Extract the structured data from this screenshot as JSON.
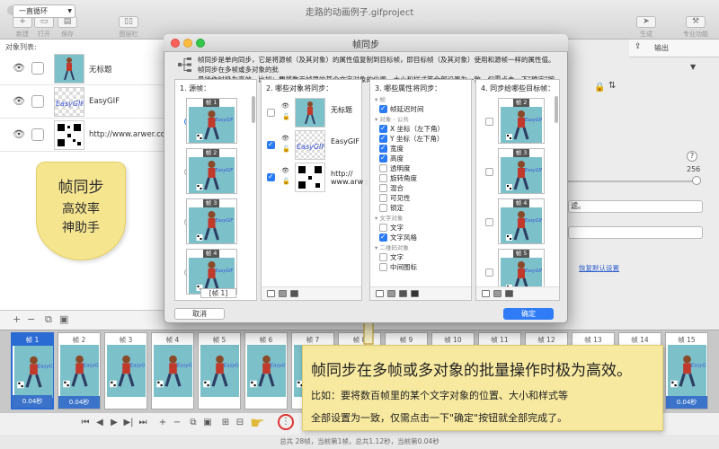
{
  "window": {
    "title": "走路的动画例子.gifproject"
  },
  "toolbar": {
    "new_label": "新建",
    "open_label": "打开",
    "save_label": "保存",
    "panel_label": "图层栏",
    "generate_label": "生成",
    "pro_label": "专业功能"
  },
  "object_panel": {
    "header": "对象列表:",
    "objects": [
      {
        "name": "无标题"
      },
      {
        "name": "EasyGIF"
      },
      {
        "name": "http://www.arwer.com"
      }
    ]
  },
  "slogan": {
    "line1": "帧同步",
    "line2": "高效率",
    "line3": "神助手"
  },
  "right_panel": {
    "export_label": "输出",
    "value_256": "256",
    "question": "?",
    "snippet1": "滤。",
    "snippet2": "恢复默认设置"
  },
  "dialog": {
    "title": "帧同步",
    "description_line1": "帧同步是单向同步，它是将源帧（及其对象）的属性值复制到目标帧，即目标帧（及其对象）使用和源帧一样的属性值。帧同步在多帧或多对象的批",
    "description_line2": "量操作时极为高效。比如：要将数百帧里的某个文字对象的位置、大小和样式等全部设置为一致，仅需点击一下\"确定\"按钮就全部完成了。",
    "col1_header": "1. 源帧：",
    "col2_header": "2. 哪些对象将同步：",
    "col3_header": "3. 哪些属性将同步：",
    "col4_header": "4. 同步给哪些目标帧：",
    "source_frames": [
      "帧 1",
      "帧 2",
      "帧 3",
      "帧 4"
    ],
    "selected_source": "帧 1",
    "objects": [
      {
        "name": "无标题",
        "checked": false
      },
      {
        "name": "EasyGIF",
        "checked": true
      },
      {
        "name": "http://\nwww.arw",
        "checked": true
      }
    ],
    "properties": [
      {
        "group": "帧"
      },
      {
        "label": "帧延迟时间",
        "checked": true
      },
      {
        "group": "对象 - 公共"
      },
      {
        "label": "X 坐标（左下角）",
        "checked": true
      },
      {
        "label": "Y 坐标（左下角）",
        "checked": true
      },
      {
        "label": "宽度",
        "checked": true
      },
      {
        "label": "高度",
        "checked": true
      },
      {
        "label": "透明度",
        "checked": false
      },
      {
        "label": "旋转角度",
        "checked": false
      },
      {
        "label": "混合",
        "checked": false
      },
      {
        "label": "可见性",
        "checked": false
      },
      {
        "label": "锁定",
        "checked": false
      },
      {
        "group": "文字对象"
      },
      {
        "label": "文字",
        "checked": false
      },
      {
        "label": "文字风格",
        "checked": true
      },
      {
        "group": "二维码对象"
      },
      {
        "label": "文字",
        "checked": false
      },
      {
        "label": "中间图标",
        "checked": false
      }
    ],
    "target_frames": [
      {
        "label": "帧 2",
        "checked": false
      },
      {
        "label": "帧 3",
        "checked": false
      },
      {
        "label": "帧 4",
        "checked": false
      },
      {
        "label": "帧 5",
        "checked": false
      }
    ],
    "source_footer": "[帧 1]",
    "cancel_label": "取消",
    "ok_label": "确定"
  },
  "frames": [
    {
      "label": "帧 1",
      "time": "0.04秒"
    },
    {
      "label": "帧 2",
      "time": "0.04秒"
    },
    {
      "label": "帧 3",
      "time": ""
    },
    {
      "label": "帧 4",
      "time": ""
    },
    {
      "label": "帧 5",
      "time": ""
    },
    {
      "label": "帧 6",
      "time": ""
    },
    {
      "label": "帧 7",
      "time": ""
    },
    {
      "label": "帧 8",
      "time": ""
    },
    {
      "label": "帧 9",
      "time": ""
    },
    {
      "label": "帧 10",
      "time": ""
    },
    {
      "label": "帧 11",
      "time": ""
    },
    {
      "label": "帧 12",
      "time": ""
    },
    {
      "label": "帧 13",
      "time": ""
    },
    {
      "label": "帧 14",
      "time": ""
    },
    {
      "label": "帧 15",
      "time": "0.04秒"
    }
  ],
  "controls": {
    "loop_label": "一直循环"
  },
  "status": "总共 28帧，当前第1帧，总共1.12秒，当前第0.04秒",
  "callout": {
    "title": "帧同步在多帧或多对象的批量操作时极为高效。",
    "line1": "比如：要将数百帧里的某个文字对象的位置、大小和样式等",
    "line2": "全部设置为一致，仅需点击一下\"确定\"按钮就全部完成了。"
  },
  "colors": {
    "accent": "#2f7cf6",
    "callout_bg": "#f8e9a0",
    "frame_bg": "#7cc0c9"
  }
}
